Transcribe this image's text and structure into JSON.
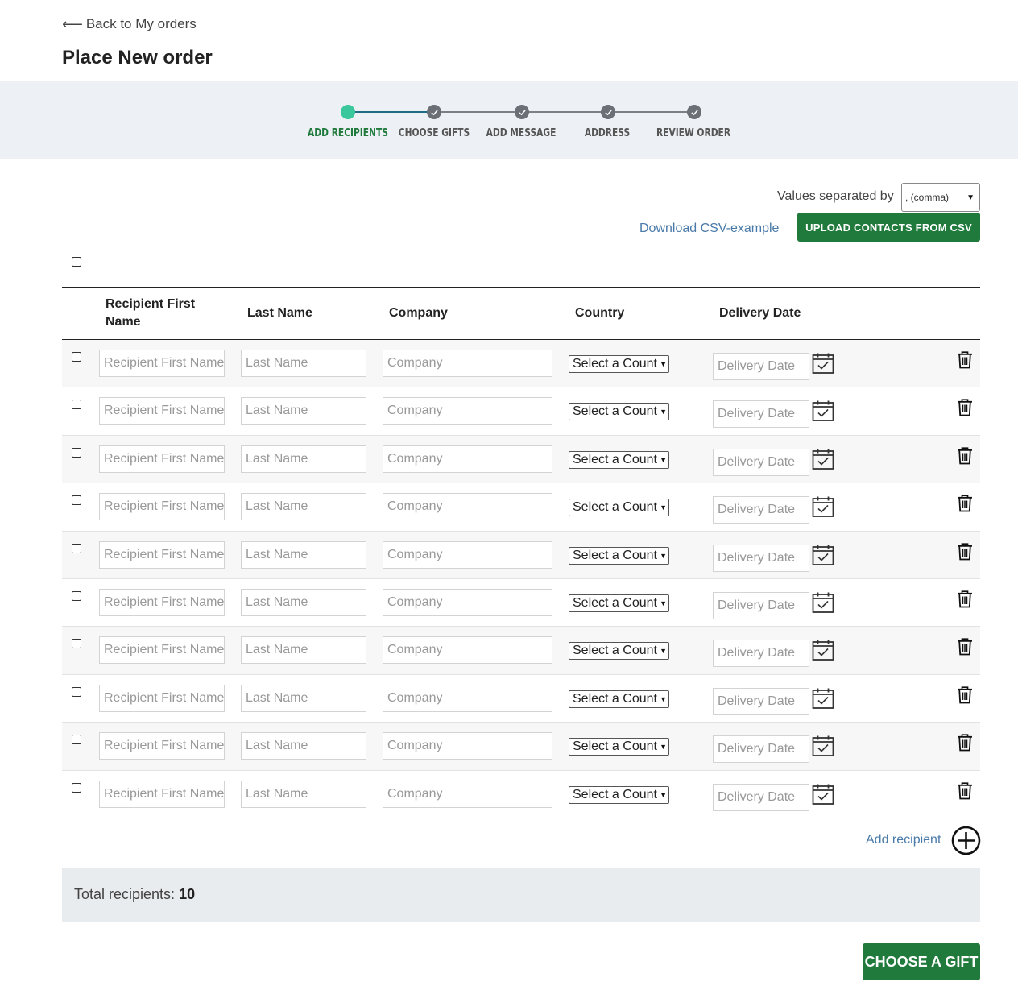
{
  "header": {
    "back_label": "Back to My orders",
    "title": "Place New order"
  },
  "steps": [
    {
      "label": "ADD RECIPIENTS",
      "state": "active"
    },
    {
      "label": "CHOOSE GIFTS",
      "state": "pending"
    },
    {
      "label": "ADD MESSAGE",
      "state": "pending"
    },
    {
      "label": "ADDRESS",
      "state": "pending"
    },
    {
      "label": "REVIEW ORDER",
      "state": "pending"
    }
  ],
  "csv": {
    "separator_label": "Values separated by",
    "separator_value": ", (comma)",
    "download_label": "Download CSV-example",
    "upload_label": "UPLOAD CONTACTS FROM CSV"
  },
  "table": {
    "columns": {
      "first_name": "Recipient First Name",
      "last_name": "Last Name",
      "company": "Company",
      "country": "Country",
      "delivery_date": "Delivery Date"
    },
    "placeholders": {
      "first_name": "Recipient First Name",
      "last_name": "Last Name",
      "company": "Company",
      "country": "Select a Country",
      "delivery_date": "Delivery Date"
    },
    "row_count": 10
  },
  "add_recipient_label": "Add recipient",
  "totals": {
    "label": "Total recipients:",
    "count": "10"
  },
  "choose_gift_label": "CHOOSE A GIFT",
  "colors": {
    "primary_green": "#1f7a3c",
    "active_step": "#3ac79c",
    "link_blue": "#4a7aa8",
    "band_gray": "#edf0f4"
  }
}
